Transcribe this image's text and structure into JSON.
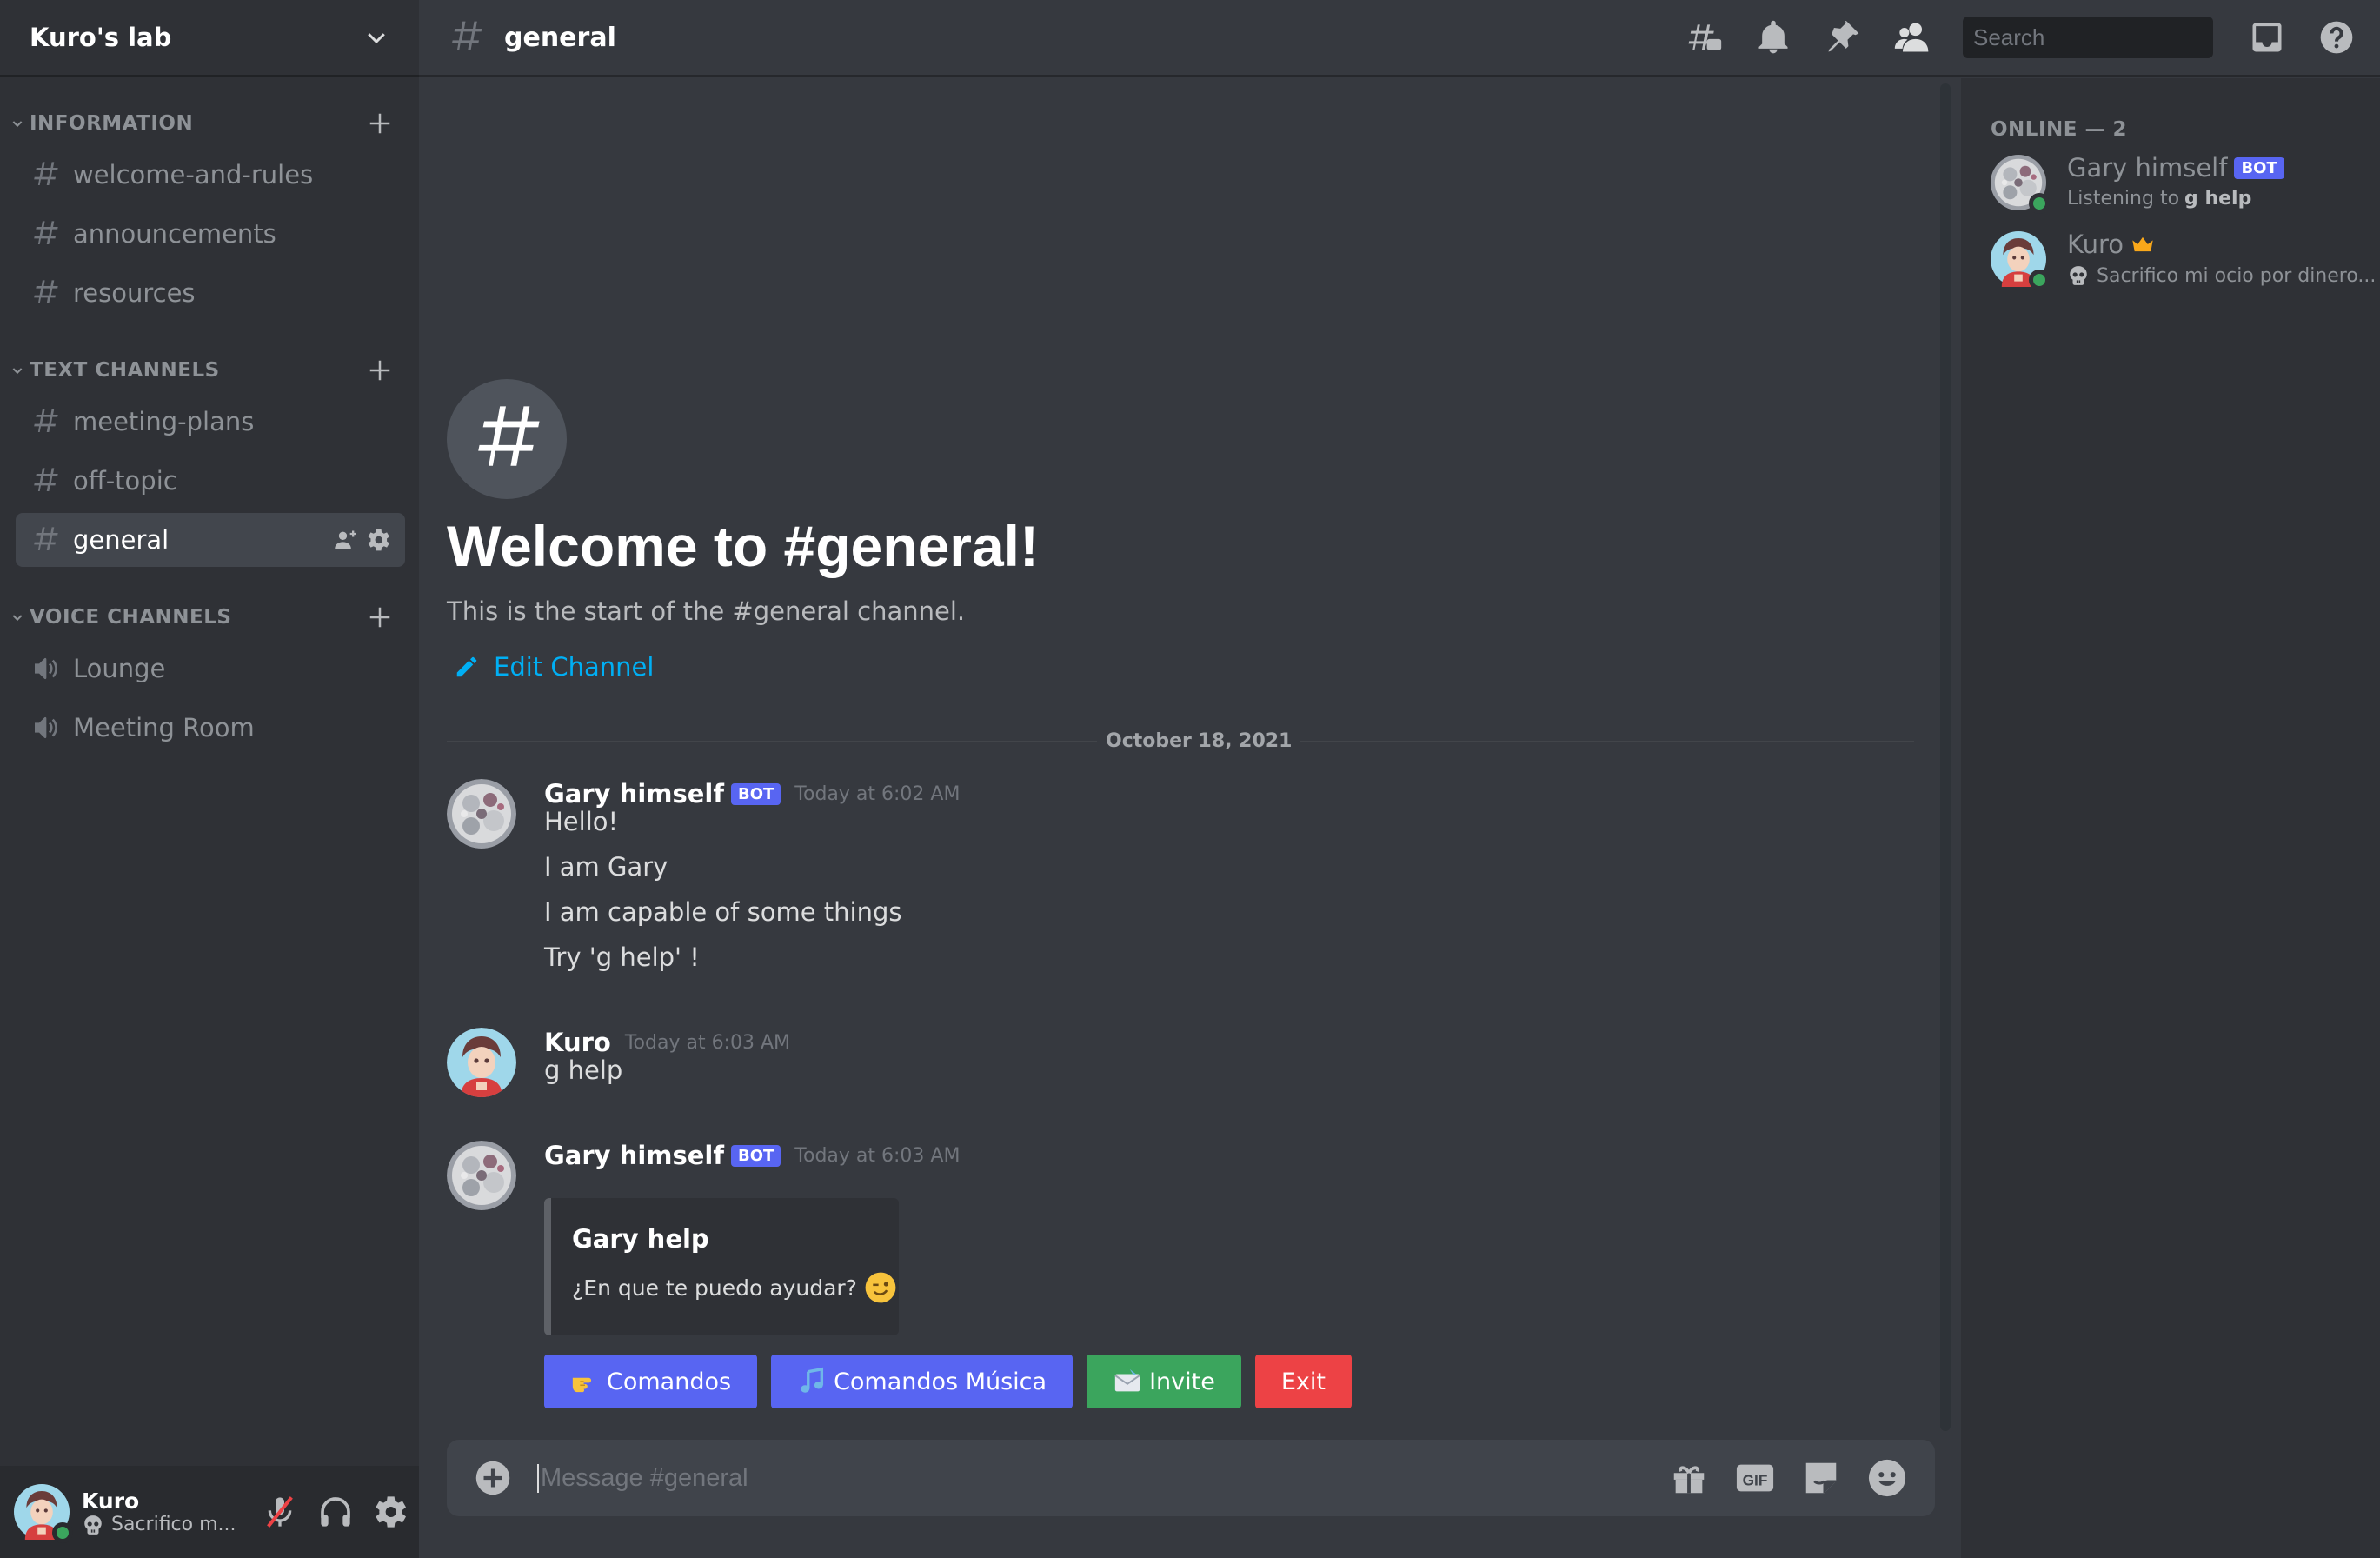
{
  "server": {
    "name": "Kuro's lab"
  },
  "sidebar": {
    "categories": [
      {
        "label": "INFORMATION",
        "channels": [
          "welcome-and-rules",
          "announcements",
          "resources"
        ]
      },
      {
        "label": "TEXT CHANNELS",
        "channels": [
          "meeting-plans",
          "off-topic",
          "general"
        ]
      },
      {
        "label": "VOICE CHANNELS",
        "channels": [
          "Lounge",
          "Meeting Room"
        ]
      }
    ],
    "active_channel": "general"
  },
  "user_panel": {
    "name": "Kuro",
    "status": "Sacrifico m..."
  },
  "topbar": {
    "channel": "general",
    "search_placeholder": "Search",
    "icons": [
      "threads-icon",
      "bell-icon",
      "pin-icon",
      "members-icon",
      "inbox-icon",
      "help-icon"
    ]
  },
  "welcome": {
    "title": "Welcome to #general!",
    "subtitle": "This is the start of the #general channel.",
    "edit_label": "Edit Channel"
  },
  "date_divider": "October 18, 2021",
  "messages": [
    {
      "author": "Gary himself",
      "bot": "BOT",
      "time": "Today at 6:02 AM",
      "lines": [
        "Hello!",
        "I am Gary",
        "I am capable of some things",
        "Try 'g help' !"
      ]
    },
    {
      "author": "Kuro",
      "time": "Today at 6:03 AM",
      "lines": [
        "g help"
      ]
    },
    {
      "author": "Gary himself",
      "bot": "BOT",
      "time": "Today at 6:03 AM",
      "embed": {
        "title": "Gary help",
        "description": "¿En que te puedo ayudar?"
      },
      "buttons": [
        "Comandos",
        "Comandos Música",
        "Invite",
        "Exit"
      ]
    }
  ],
  "composer": {
    "placeholder": "Message #general"
  },
  "members": {
    "header": "ONLINE — 2",
    "list": [
      {
        "name": "Gary himself",
        "bot": "BOT",
        "activity_prefix": "Listening to",
        "activity": "g help"
      },
      {
        "name": "Kuro",
        "custom_status": "Sacrifico mi ocio por dinero..."
      }
    ]
  },
  "colors": {
    "blurple": "#5865f2",
    "green": "#3ba55d",
    "red": "#ed4245",
    "link": "#00aff4",
    "background": "#36393f",
    "sidebar": "#2f3136"
  }
}
